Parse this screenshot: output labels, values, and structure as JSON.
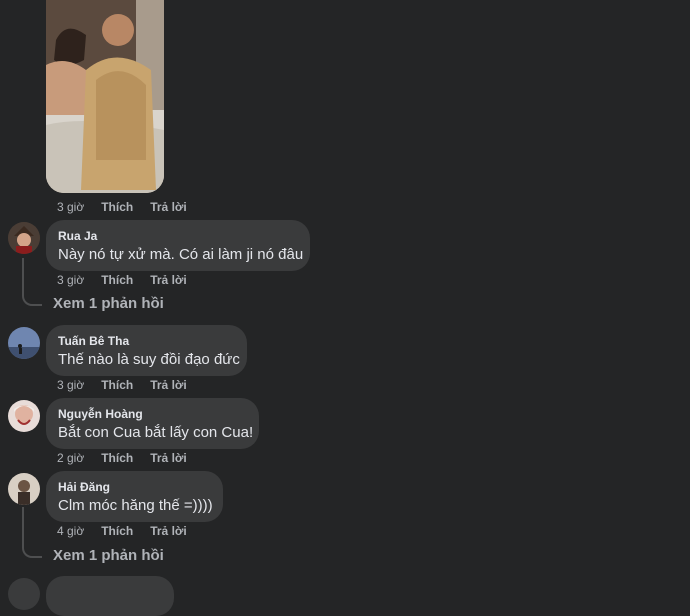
{
  "post": {
    "meta": {
      "time": "3 giờ",
      "like": "Thích",
      "reply": "Trả lời"
    }
  },
  "comments": [
    {
      "name": "Rua Ja",
      "text": "Này nó tự xử mà. Có ai làm ji nó đâu",
      "time": "3 giờ",
      "like": "Thích",
      "reply": "Trả lời",
      "replies_label": "Xem 1 phản hồi"
    },
    {
      "name": "Tuấn Bê Tha",
      "text": "Thế nào là suy đồi đạo đức",
      "time": "3 giờ",
      "like": "Thích",
      "reply": "Trả lời"
    },
    {
      "name": "Nguyễn Hoàng",
      "text": "Bắt con Cua bắt lấy con Cua!",
      "time": "2 giờ",
      "like": "Thích",
      "reply": "Trả lời"
    },
    {
      "name": "Hải Đăng",
      "text": "Clm móc hăng thế =))))",
      "time": "4 giờ",
      "like": "Thích",
      "reply": "Trả lời",
      "replies_label": "Xem 1 phản hồi"
    }
  ],
  "colors": {
    "background": "#242526",
    "bubble": "#3a3b3c",
    "text": "#e4e6eb",
    "muted": "#b0b3b8"
  }
}
